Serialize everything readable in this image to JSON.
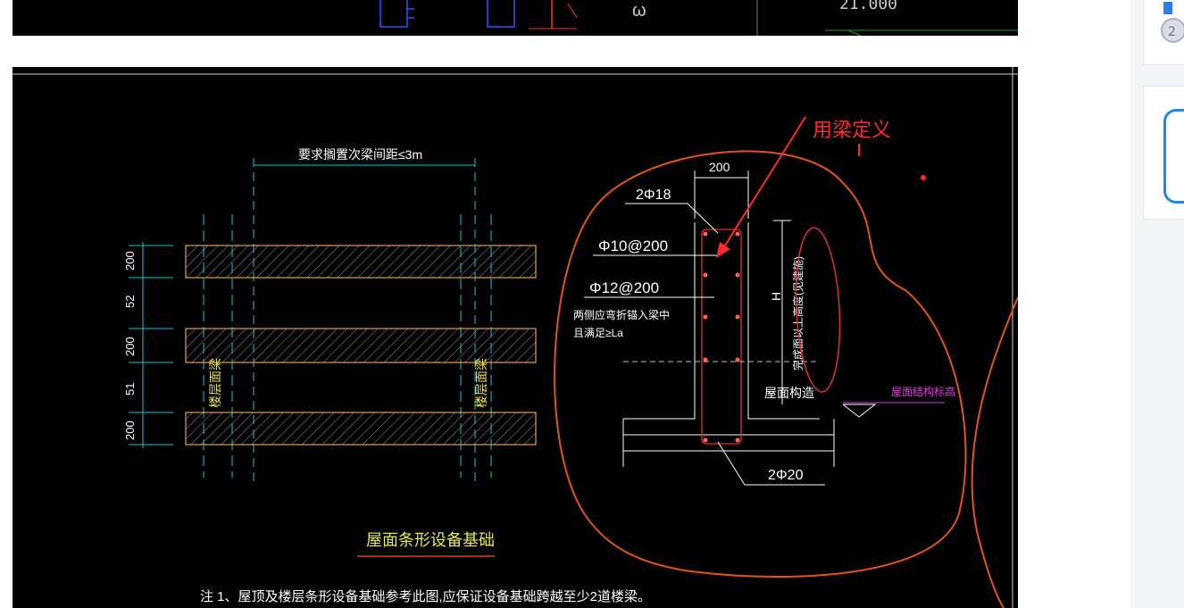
{
  "top_strip": {
    "symbol": "ω",
    "level_text": "21.000"
  },
  "drawing": {
    "dim_top": "要求搁置次梁间距≤3m",
    "left_dims": [
      "200",
      "52",
      "200",
      "51",
      "200"
    ],
    "beam_label": "楼层面梁",
    "title": "屋面条形设备基础",
    "note": "注  1、屋顶及楼层条形设备基础参考此图,应保证设备基础跨越至少2道楼梁。",
    "section": {
      "width_dim": "200",
      "top_bars": "2Φ18",
      "stirrup": "Φ10@200",
      "side_bars": "Φ12@200",
      "bend_note_1": "两侧应弯折锚入梁中",
      "bend_note_2": "且满足≥La",
      "height_label": "H",
      "vertical_note": "完成面以上高度(见建施)",
      "roof_layer": "屋面构造",
      "elevation_label": "屋面结构标高",
      "bottom_bars": "2Φ20"
    },
    "annotation": "用梁定义"
  },
  "colors": {
    "cad_bg": "#000000",
    "annotation_red": "#ff2a2a",
    "markup_orange": "#e0561a",
    "dim_cyan": "#19c6d8",
    "label_yellow": "#e6e65a",
    "elevation_magenta": "#e040e0"
  },
  "sidebar": {
    "card1_icon": "medal-icon",
    "card2_icon": "frame-icon"
  }
}
